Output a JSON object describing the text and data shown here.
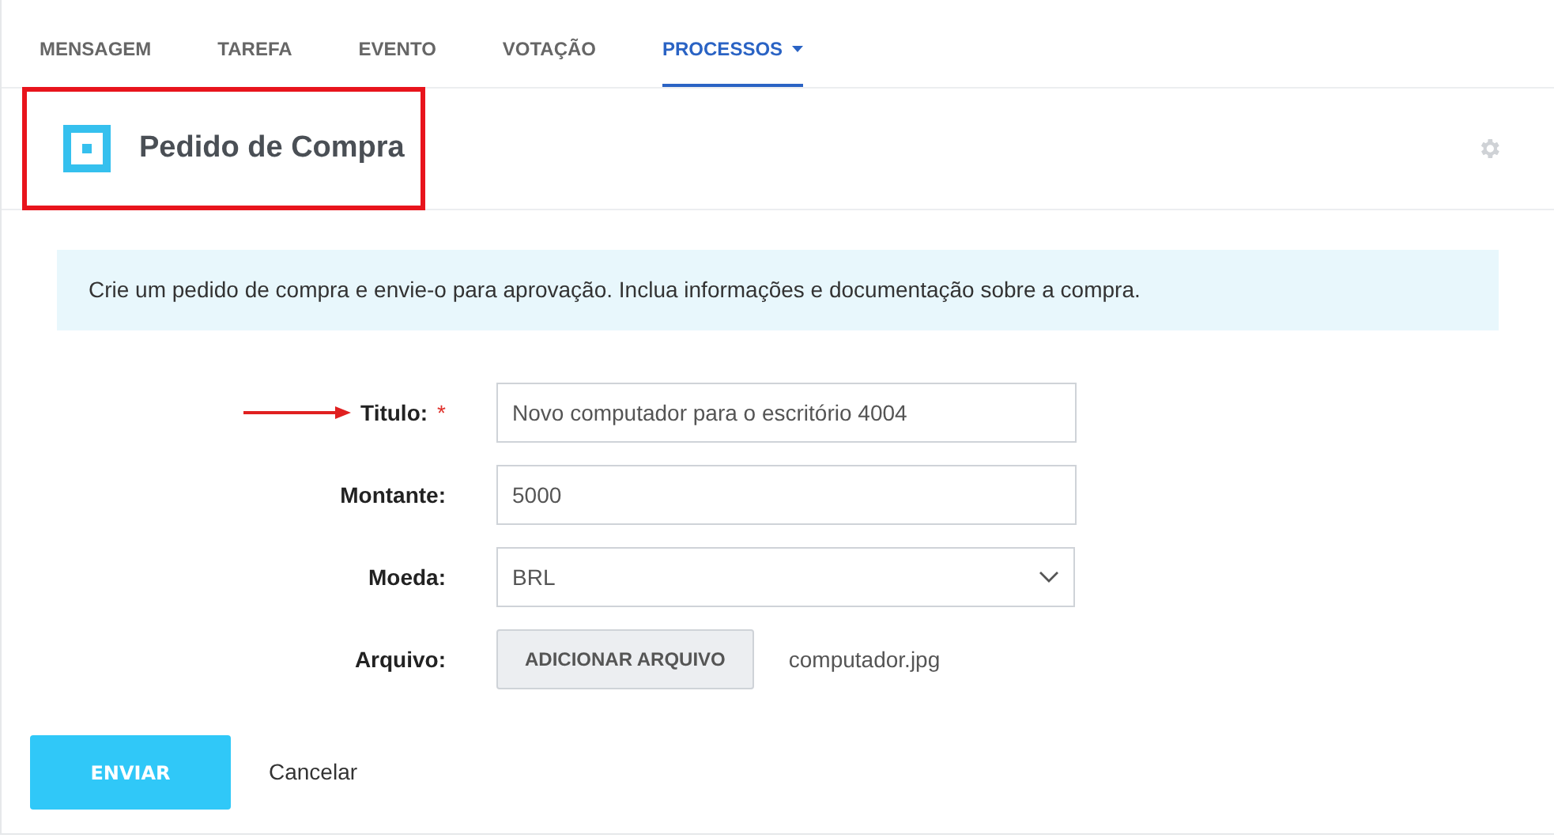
{
  "tabs": [
    {
      "label": "MENSAGEM",
      "selected": false,
      "dropdown": false
    },
    {
      "label": "TAREFA",
      "selected": false,
      "dropdown": false
    },
    {
      "label": "EVENTO",
      "selected": false,
      "dropdown": false
    },
    {
      "label": "VOTAÇÃO",
      "selected": false,
      "dropdown": false
    },
    {
      "label": "PROCESSOS",
      "selected": true,
      "dropdown": true
    }
  ],
  "header": {
    "title": "Pedido de Compra",
    "highlighted": true
  },
  "info": "Crie um pedido de compra e envie-o para aprovação. Inclua informações e documentação sobre a compra.",
  "fields": [
    {
      "kind": "text",
      "label": "Titulo:",
      "required_mark": "*",
      "annotated": true,
      "value": "Novo computador para o escritório 4004"
    },
    {
      "kind": "text",
      "label": "Montante:",
      "annotated": false,
      "value": "5000"
    },
    {
      "kind": "select",
      "label": "Moeda:",
      "annotated": false,
      "value": "BRL"
    },
    {
      "kind": "file",
      "label": "Arquivo:",
      "annotated": false,
      "button": "ADICIONAR ARQUIVO",
      "file_name": "computador.jpg"
    }
  ],
  "actions": {
    "submit": "ENVIAR",
    "cancel": "Cancelar"
  }
}
